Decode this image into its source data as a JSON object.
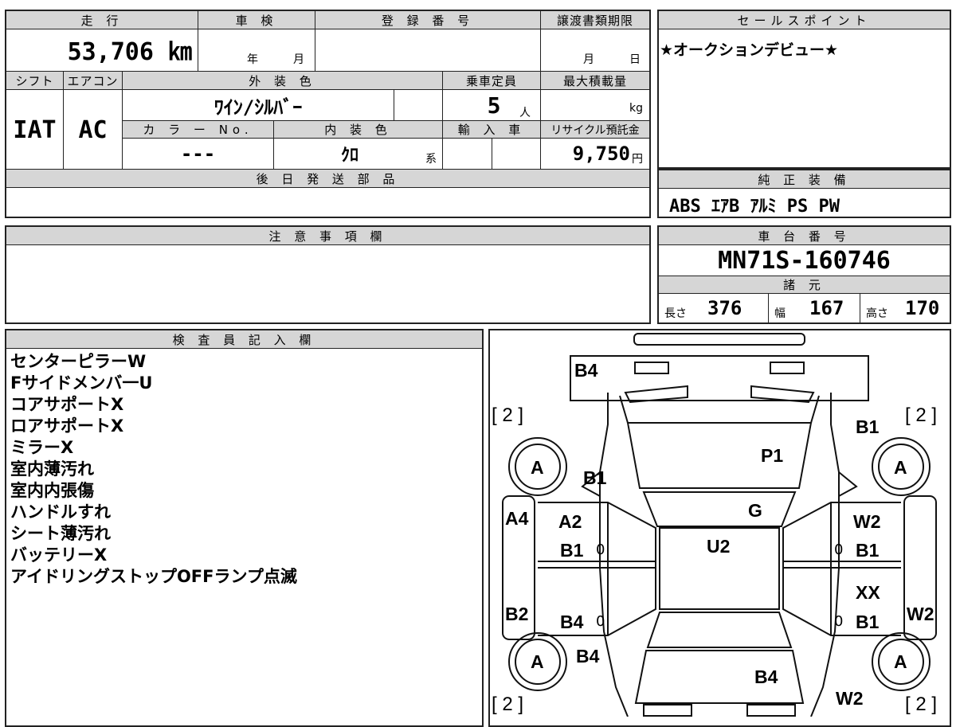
{
  "main": {
    "mileage_header": "走 行",
    "mileage_value": "53,706 ㎞",
    "inspection_header": "車 検",
    "inspection_year": "年",
    "inspection_month": "月",
    "registration_header": "登 録 番 号",
    "transfer_header": "譲渡書類期限",
    "transfer_month": "月",
    "transfer_day": "日",
    "shift_header": "シフト",
    "shift_value": "IAT",
    "aircon_header": "エアコン",
    "aircon_value": "AC",
    "exterior_color_header": "外 装 色",
    "exterior_color_value": "ﾜｲﾝ/ｼﾙﾊﾞｰ",
    "capacity_header": "乗車定員",
    "capacity_value": "5",
    "capacity_unit": "人",
    "max_load_header": "最大積載量",
    "max_load_unit": "kg",
    "color_no_header": "カ ラ ー No.",
    "color_no_value": "---",
    "interior_color_header": "内 装 色",
    "interior_color_value": "ｸﾛ",
    "interior_color_suffix": "系",
    "import_header": "輸 入 車",
    "recycle_header": "リサイクル預託金",
    "recycle_value": "9,750",
    "recycle_unit": "円",
    "later_parts_header": "後 日 発 送 部 品"
  },
  "sales_point": {
    "header": "セールスポイント",
    "text": "★オークションデビュー★"
  },
  "equipment": {
    "header": "純 正 装 備",
    "text": "ABS ｴｱB ｱﾙﾐ PS PW"
  },
  "caution": {
    "header": "注 意 事 項 欄"
  },
  "chassis": {
    "header": "車 台 番 号",
    "value": "MN71S-160746",
    "specs_header": "諸 元",
    "length_label": "長さ",
    "length_value": "376",
    "width_label": "幅",
    "width_value": "167",
    "height_label": "高さ",
    "height_value": "170"
  },
  "inspector": {
    "header": "検 査 員 記 入 欄",
    "notes": [
      "センターピラーW",
      "Fサイドメンバ一U",
      "コアサポートX",
      "ロアサポートX",
      "ミラーX",
      "室内薄汚れ",
      "室内内張傷",
      "ハンドルすれ",
      "シート薄汚れ",
      "バッテリーX",
      "アイドリングストップOFFランプ点滅"
    ]
  },
  "diagram": {
    "bracket_tl": "[ 2 ]",
    "bracket_tr": "[ 2 ]",
    "bracket_bl": "[ 2 ]",
    "bracket_br": "[ 2 ]",
    "tire_fl": "A",
    "tire_fr": "A",
    "tire_rl": "A",
    "tire_rr": "A",
    "front_bumper": "B4",
    "left_front_fender": "B1",
    "right_front_fender": "B1",
    "hood": "P1",
    "windshield": "G",
    "roof": "U2",
    "left_pillar": "A4",
    "left_front_door_1": "A2",
    "left_front_door_2": "B1",
    "left_front_door_mark": "0",
    "left_rear_door": "B4",
    "left_rear_door_mark": "0",
    "left_rocker": "B2",
    "left_rear_fender": "B4",
    "right_front_door_1": "W2",
    "right_front_door_2": "B1",
    "right_front_door_mark": "0",
    "right_rear_door_1": "XX",
    "right_rear_door_2": "B1",
    "right_rear_door_mark": "0",
    "right_rocker": "W2",
    "rear_gate": "B4",
    "right_rear_fender": "W2"
  }
}
